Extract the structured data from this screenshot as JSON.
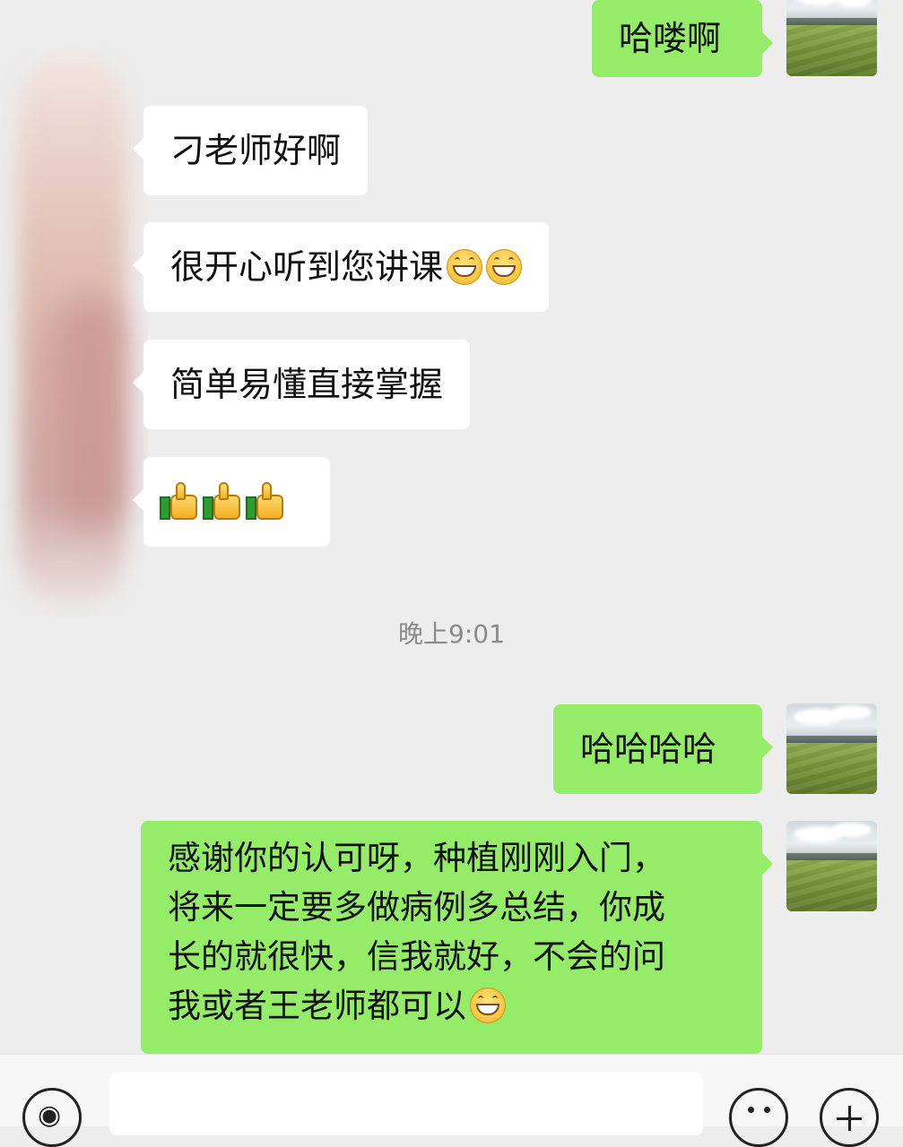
{
  "chat": {
    "messages": [
      {
        "side": "right",
        "text": "哈喽啊"
      },
      {
        "side": "left",
        "text": "刁老师好啊"
      },
      {
        "side": "left",
        "text": "很开心听到您讲课",
        "emoji": [
          "grinning-face",
          "grinning-face"
        ]
      },
      {
        "side": "left",
        "text": "简单易懂直接掌握"
      },
      {
        "side": "left",
        "emoji": [
          "thumbs-up",
          "thumbs-up",
          "thumbs-up"
        ]
      },
      {
        "side": "right",
        "text": "哈哈哈哈"
      },
      {
        "side": "right",
        "lines": [
          "感谢你的认可呀，种植刚刚入门，",
          "将来一定要多做病例多总结，你成",
          "长的就很快，信我就好，不会的问",
          "我或者王老师都可以"
        ],
        "emoji": [
          "grinning-face"
        ]
      }
    ],
    "timestamp": "晚上9:01"
  },
  "input_bar": {
    "voice_icon": "voice-icon",
    "emoji_icon": "emoji-icon",
    "plus_icon": "plus-icon",
    "input_value": ""
  },
  "colors": {
    "background": "#ededed",
    "self_bubble": "#95ec69",
    "other_bubble": "#ffffff",
    "timestamp": "#8a8a8a"
  }
}
